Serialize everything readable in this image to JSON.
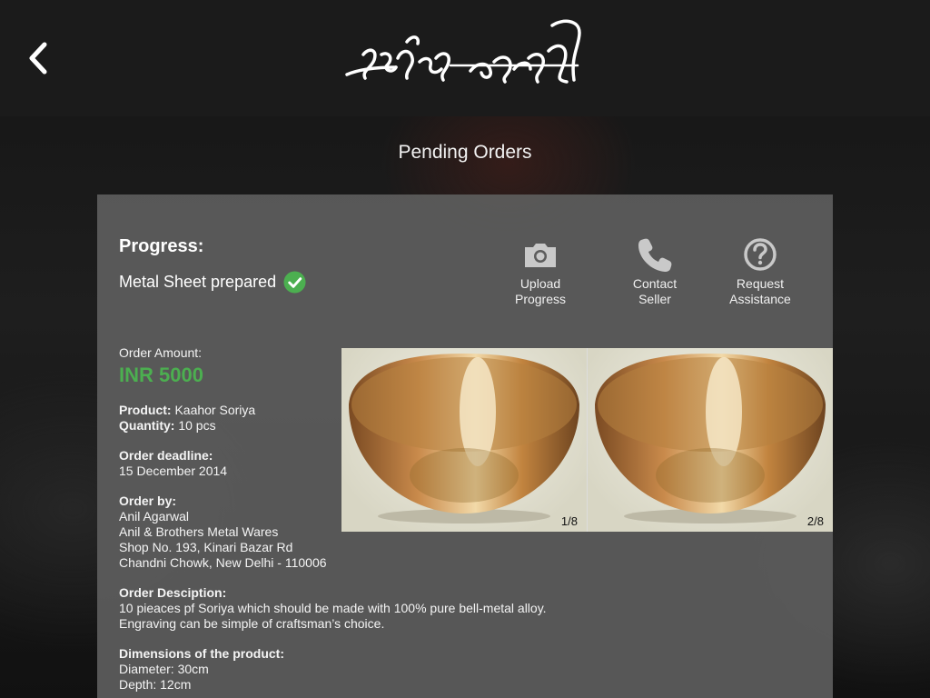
{
  "header": {
    "logo_alt": "কাঁহৰ শৰাই"
  },
  "page_title": "Pending Orders",
  "progress": {
    "heading": "Progress:",
    "status": "Metal Sheet prepared"
  },
  "actions": {
    "upload": {
      "line1": "Upload",
      "line2": "Progress",
      "icon": "camera-icon"
    },
    "contact": {
      "line1": "Contact",
      "line2": "Seller",
      "icon": "phone-icon"
    },
    "request": {
      "line1": "Request",
      "line2": "Assistance",
      "icon": "question-icon"
    }
  },
  "order": {
    "amount_label": "Order Amount:",
    "amount": "INR 5000",
    "product_label": "Product:",
    "product": "Kaahor Soriya",
    "quantity_label": "Quantity:",
    "quantity": "10 pcs",
    "deadline_label": "Order deadline:",
    "deadline": "15 December 2014",
    "by_label": "Order by:",
    "by_lines": [
      "Anil Agarwal",
      "Anil & Brothers Metal Wares",
      "Shop No. 193, Kinari Bazar Rd",
      "Chandni Chowk, New Delhi - 110006"
    ],
    "desc_label": "Order Desciption:",
    "desc_lines": [
      "10 pieaces pf Soriya which should be made with 100% pure bell-metal alloy.",
      "Engraving can be simple of craftsman’s choice."
    ],
    "dims_label": "Dimensions of the product:",
    "dims_lines": [
      "Diameter: 30cm",
      "Depth: 12cm"
    ]
  },
  "gallery": {
    "photos": [
      {
        "counter": "1/8"
      },
      {
        "counter": "2/8"
      }
    ]
  },
  "colors": {
    "accent_green": "#4caf50",
    "card_bg": "#5c5c5c"
  }
}
